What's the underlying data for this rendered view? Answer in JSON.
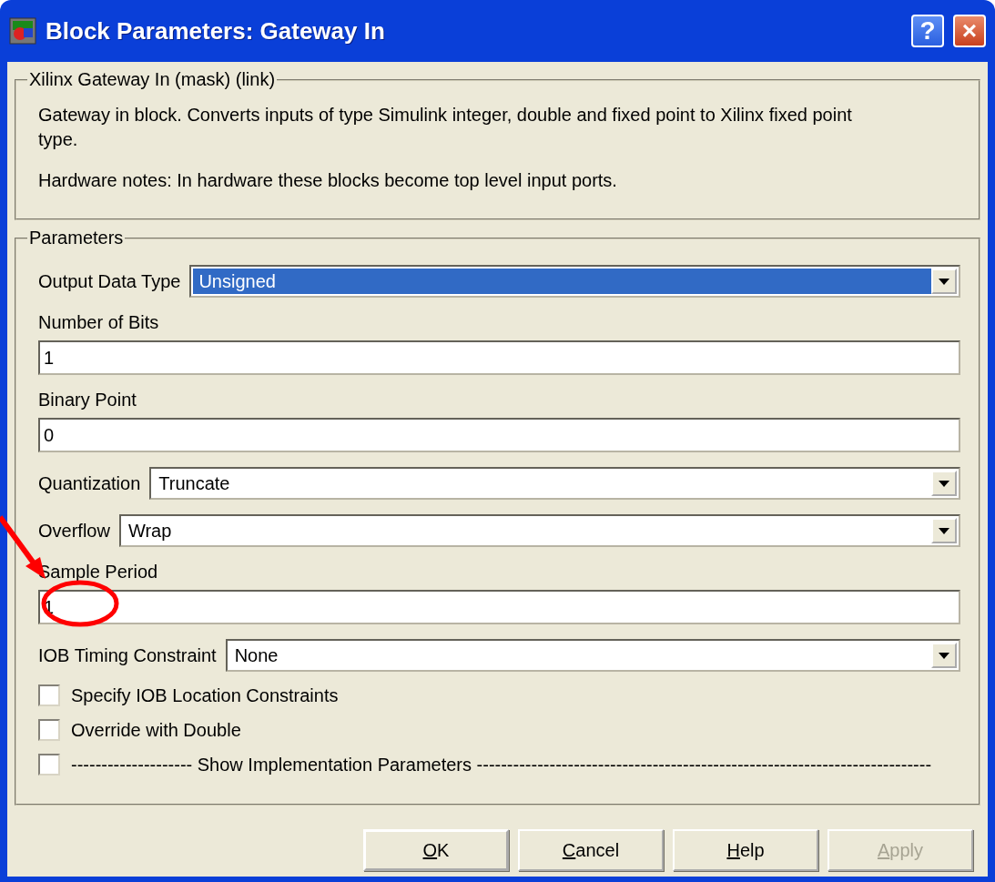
{
  "window": {
    "title": "Block Parameters: Gateway In",
    "title_buttons": [
      "?",
      "×"
    ]
  },
  "description": {
    "legend": "Xilinx Gateway In (mask) (link)",
    "paragraphs": [
      "Gateway in block.  Converts inputs of type Simulink integer, double and fixed point to  Xilinx fixed point type.",
      "Hardware notes:  In hardware these blocks become top level input ports."
    ]
  },
  "parameters": {
    "legend": "Parameters",
    "items": [
      {
        "kind": "dropdown",
        "label": "Output Data Type",
        "value": "Unsigned",
        "highlighted": true
      },
      {
        "kind": "text",
        "label": "Number of Bits",
        "value": "1"
      },
      {
        "kind": "text",
        "label": "Binary Point",
        "value": "0"
      },
      {
        "kind": "dropdown",
        "label": "Quantization",
        "value": "Truncate",
        "highlighted": false
      },
      {
        "kind": "dropdown",
        "label": "Overflow",
        "value": "Wrap",
        "highlighted": false
      },
      {
        "kind": "text",
        "label": "Sample Period",
        "value": "1"
      },
      {
        "kind": "dropdown",
        "label": "IOB Timing Constraint",
        "value": "None",
        "highlighted": false
      },
      {
        "kind": "checkbox",
        "label": "Specify IOB Location Constraints",
        "checked": false
      },
      {
        "kind": "checkbox",
        "label": "Override with Double",
        "checked": false
      },
      {
        "kind": "checkbox",
        "label": "-------------------- Show Implementation Parameters ---------------------------------------------------------------------------",
        "checked": false
      }
    ]
  },
  "buttons": [
    {
      "label": "OK",
      "disabled": false,
      "default": true
    },
    {
      "label": "Cancel",
      "disabled": false,
      "default": false
    },
    {
      "label": "Help",
      "disabled": false,
      "default": false
    },
    {
      "label": "Apply",
      "disabled": true,
      "default": false
    }
  ]
}
